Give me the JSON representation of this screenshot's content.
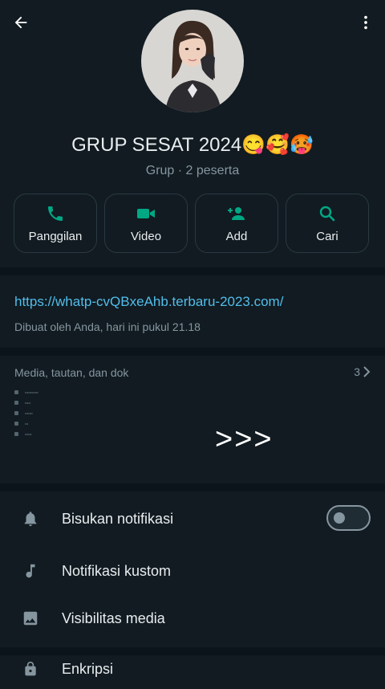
{
  "header": {
    "group_name": "GRUP SESAT 2024😋🥰🥵",
    "subtitle": "Grup · 2 peserta"
  },
  "actions": [
    {
      "label": "Panggilan",
      "icon": "phone-icon"
    },
    {
      "label": "Video",
      "icon": "video-icon"
    },
    {
      "label": "Add",
      "icon": "add-person-icon"
    },
    {
      "label": "Cari",
      "icon": "search-icon"
    }
  ],
  "info": {
    "link": "https://whatp-cvQBxeAhb.terbaru-2023.com/",
    "created": "Dibuat oleh Anda, hari ini pukul 21.18"
  },
  "media": {
    "header": "Media, tautan, dan dok",
    "count": "3",
    "overlay": ">>>"
  },
  "settings": {
    "mute": "Bisukan notifikasi",
    "custom": "Notifikasi kustom",
    "visibility": "Visibilitas media",
    "encryption": "Enkripsi"
  },
  "colors": {
    "background": "#111b21",
    "accent": "#00a884",
    "link": "#53bdeb"
  }
}
